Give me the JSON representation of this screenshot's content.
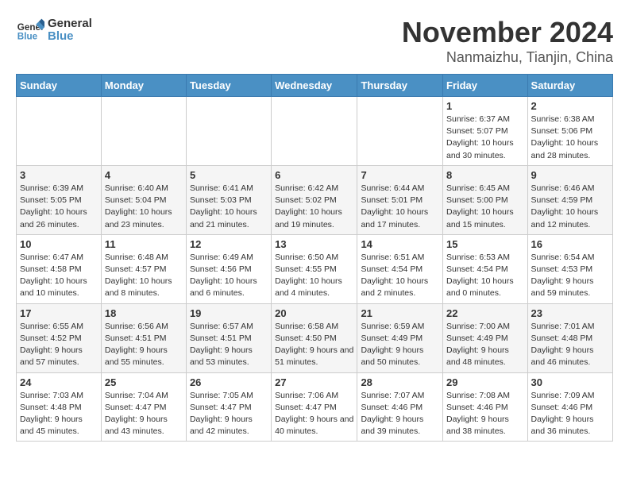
{
  "logo": {
    "line1": "General",
    "line2": "Blue"
  },
  "title": "November 2024",
  "location": "Nanmaizhu, Tianjin, China",
  "weekdays": [
    "Sunday",
    "Monday",
    "Tuesday",
    "Wednesday",
    "Thursday",
    "Friday",
    "Saturday"
  ],
  "weeks": [
    [
      {
        "day": "",
        "info": ""
      },
      {
        "day": "",
        "info": ""
      },
      {
        "day": "",
        "info": ""
      },
      {
        "day": "",
        "info": ""
      },
      {
        "day": "",
        "info": ""
      },
      {
        "day": "1",
        "info": "Sunrise: 6:37 AM\nSunset: 5:07 PM\nDaylight: 10 hours and 30 minutes."
      },
      {
        "day": "2",
        "info": "Sunrise: 6:38 AM\nSunset: 5:06 PM\nDaylight: 10 hours and 28 minutes."
      }
    ],
    [
      {
        "day": "3",
        "info": "Sunrise: 6:39 AM\nSunset: 5:05 PM\nDaylight: 10 hours and 26 minutes."
      },
      {
        "day": "4",
        "info": "Sunrise: 6:40 AM\nSunset: 5:04 PM\nDaylight: 10 hours and 23 minutes."
      },
      {
        "day": "5",
        "info": "Sunrise: 6:41 AM\nSunset: 5:03 PM\nDaylight: 10 hours and 21 minutes."
      },
      {
        "day": "6",
        "info": "Sunrise: 6:42 AM\nSunset: 5:02 PM\nDaylight: 10 hours and 19 minutes."
      },
      {
        "day": "7",
        "info": "Sunrise: 6:44 AM\nSunset: 5:01 PM\nDaylight: 10 hours and 17 minutes."
      },
      {
        "day": "8",
        "info": "Sunrise: 6:45 AM\nSunset: 5:00 PM\nDaylight: 10 hours and 15 minutes."
      },
      {
        "day": "9",
        "info": "Sunrise: 6:46 AM\nSunset: 4:59 PM\nDaylight: 10 hours and 12 minutes."
      }
    ],
    [
      {
        "day": "10",
        "info": "Sunrise: 6:47 AM\nSunset: 4:58 PM\nDaylight: 10 hours and 10 minutes."
      },
      {
        "day": "11",
        "info": "Sunrise: 6:48 AM\nSunset: 4:57 PM\nDaylight: 10 hours and 8 minutes."
      },
      {
        "day": "12",
        "info": "Sunrise: 6:49 AM\nSunset: 4:56 PM\nDaylight: 10 hours and 6 minutes."
      },
      {
        "day": "13",
        "info": "Sunrise: 6:50 AM\nSunset: 4:55 PM\nDaylight: 10 hours and 4 minutes."
      },
      {
        "day": "14",
        "info": "Sunrise: 6:51 AM\nSunset: 4:54 PM\nDaylight: 10 hours and 2 minutes."
      },
      {
        "day": "15",
        "info": "Sunrise: 6:53 AM\nSunset: 4:54 PM\nDaylight: 10 hours and 0 minutes."
      },
      {
        "day": "16",
        "info": "Sunrise: 6:54 AM\nSunset: 4:53 PM\nDaylight: 9 hours and 59 minutes."
      }
    ],
    [
      {
        "day": "17",
        "info": "Sunrise: 6:55 AM\nSunset: 4:52 PM\nDaylight: 9 hours and 57 minutes."
      },
      {
        "day": "18",
        "info": "Sunrise: 6:56 AM\nSunset: 4:51 PM\nDaylight: 9 hours and 55 minutes."
      },
      {
        "day": "19",
        "info": "Sunrise: 6:57 AM\nSunset: 4:51 PM\nDaylight: 9 hours and 53 minutes."
      },
      {
        "day": "20",
        "info": "Sunrise: 6:58 AM\nSunset: 4:50 PM\nDaylight: 9 hours and 51 minutes."
      },
      {
        "day": "21",
        "info": "Sunrise: 6:59 AM\nSunset: 4:49 PM\nDaylight: 9 hours and 50 minutes."
      },
      {
        "day": "22",
        "info": "Sunrise: 7:00 AM\nSunset: 4:49 PM\nDaylight: 9 hours and 48 minutes."
      },
      {
        "day": "23",
        "info": "Sunrise: 7:01 AM\nSunset: 4:48 PM\nDaylight: 9 hours and 46 minutes."
      }
    ],
    [
      {
        "day": "24",
        "info": "Sunrise: 7:03 AM\nSunset: 4:48 PM\nDaylight: 9 hours and 45 minutes."
      },
      {
        "day": "25",
        "info": "Sunrise: 7:04 AM\nSunset: 4:47 PM\nDaylight: 9 hours and 43 minutes."
      },
      {
        "day": "26",
        "info": "Sunrise: 7:05 AM\nSunset: 4:47 PM\nDaylight: 9 hours and 42 minutes."
      },
      {
        "day": "27",
        "info": "Sunrise: 7:06 AM\nSunset: 4:47 PM\nDaylight: 9 hours and 40 minutes."
      },
      {
        "day": "28",
        "info": "Sunrise: 7:07 AM\nSunset: 4:46 PM\nDaylight: 9 hours and 39 minutes."
      },
      {
        "day": "29",
        "info": "Sunrise: 7:08 AM\nSunset: 4:46 PM\nDaylight: 9 hours and 38 minutes."
      },
      {
        "day": "30",
        "info": "Sunrise: 7:09 AM\nSunset: 4:46 PM\nDaylight: 9 hours and 36 minutes."
      }
    ]
  ]
}
